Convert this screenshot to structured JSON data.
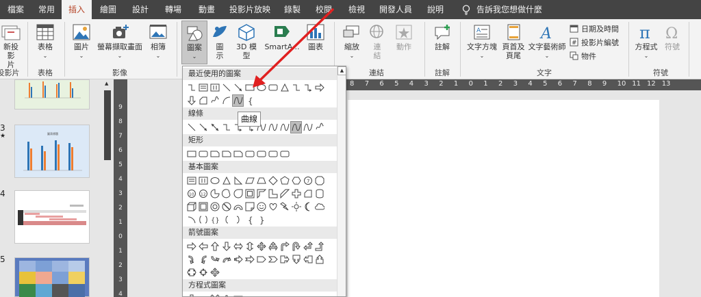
{
  "tabs": [
    "檔案",
    "常用",
    "插入",
    "繪圖",
    "設計",
    "轉場",
    "動畫",
    "投影片放映",
    "錄製",
    "校閱",
    "檢視",
    "開發人員",
    "說明"
  ],
  "active_tab": "插入",
  "tell_me": "告訴我您想做什麼",
  "ribbon": {
    "new_slide": "新投影片",
    "new_slide_line1": "新投影",
    "new_slide_line2": "片",
    "group_slides_cut": "投影片",
    "table": "表格",
    "group_table": "表格",
    "pictures": "圖片",
    "screenshot": "螢幕擷取畫面",
    "photo_album": "相簿",
    "group_images": "影像",
    "shapes": "圖案",
    "icons_line1": "圖",
    "icons_line2": "示",
    "model3d_line1": "3D 模",
    "model3d_line2": "型",
    "smartart": "SmartA...",
    "chart": "圖表",
    "zoom": "縮放",
    "link_line1": "連",
    "link_line2": "結",
    "action": "動作",
    "group_links": "連結",
    "comment": "註解",
    "group_comments": "註解",
    "textbox": "文字方塊",
    "header_footer_line1": "頁首及",
    "header_footer_line2": "頁尾",
    "wordart": "文字藝術師",
    "date_time": "日期及時間",
    "slide_number": "投影片編號",
    "object": "物件",
    "group_text": "文字",
    "equation": "方程式",
    "symbol": "符號",
    "group_symbols": "符號"
  },
  "shapes_panel": {
    "recent": "最近使用的圖案",
    "lines": "線條",
    "rectangles": "矩形",
    "basic": "基本圖案",
    "arrows": "箭號圖案",
    "equation": "方程式圖案",
    "tooltip": "曲線"
  },
  "slides": {
    "numbers": [
      "3",
      "4",
      "5"
    ],
    "thumb3_title": "圖表標題"
  },
  "vruler_ticks": [
    "9",
    "8",
    "7",
    "6",
    "5",
    "4",
    "3",
    "2",
    "1",
    "0",
    "1",
    "2",
    "3",
    "4"
  ],
  "hruler_ticks": [
    "8",
    "7",
    "6",
    "5",
    "4",
    "3",
    "2",
    "1",
    "0",
    "1",
    "2",
    "3",
    "4",
    "5",
    "6",
    "7",
    "8",
    "9",
    "10",
    "11",
    "12",
    "13"
  ],
  "colors": {
    "accent": "#b7472a",
    "tabbar": "#444444",
    "ribbon": "#f3f3f3",
    "annotation_arrow": "#e02020"
  },
  "icons": {
    "tell_me": "lightbulb-icon",
    "annotation": "red-arrow-icon"
  }
}
